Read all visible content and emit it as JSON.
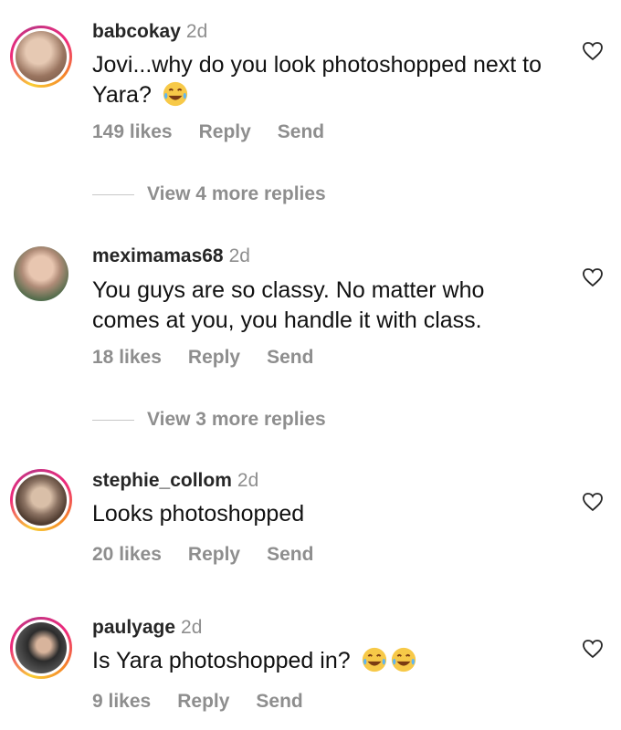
{
  "comments": [
    {
      "username": "babcokay",
      "time": "2d",
      "text": "Jovi...why do you look photoshopped next to Yara?",
      "emoji_count": 1,
      "likes": "149 likes",
      "reply": "Reply",
      "send": "Send",
      "view_replies": "View 4 more replies",
      "avatar_ring": true,
      "avatar_colors": [
        "#c9a88d",
        "#8a6a52"
      ]
    },
    {
      "username": "meximamas68",
      "time": "2d",
      "text": "You guys are so classy. No matter who comes at you, you handle it with class.",
      "emoji_count": 0,
      "likes": "18 likes",
      "reply": "Reply",
      "send": "Send",
      "view_replies": "View 3 more replies",
      "avatar_ring": false,
      "avatar_colors": [
        "#d8b7a0",
        "#7a8f6a"
      ]
    },
    {
      "username": "stephie_collom",
      "time": "2d",
      "text": "Looks photoshopped",
      "emoji_count": 0,
      "likes": "20 likes",
      "reply": "Reply",
      "send": "Send",
      "view_replies": "",
      "avatar_ring": true,
      "avatar_colors": [
        "#a89282",
        "#5a4638"
      ]
    },
    {
      "username": "paulyage",
      "time": "2d",
      "text": "Is Yara photoshopped in?",
      "emoji_count": 2,
      "likes": "9 likes",
      "reply": "Reply",
      "send": "Send",
      "view_replies": "",
      "avatar_ring": true,
      "avatar_colors": [
        "#3a3a3a",
        "#c8c8c8"
      ]
    }
  ],
  "icons": {
    "like": "heart-outline-icon",
    "emoji": "tears-of-joy-emoji-icon"
  },
  "colors": {
    "muted": "#8e8e8e",
    "username": "#262626",
    "ring_start": "#f9ce34",
    "ring_end": "#ee2a7b"
  }
}
